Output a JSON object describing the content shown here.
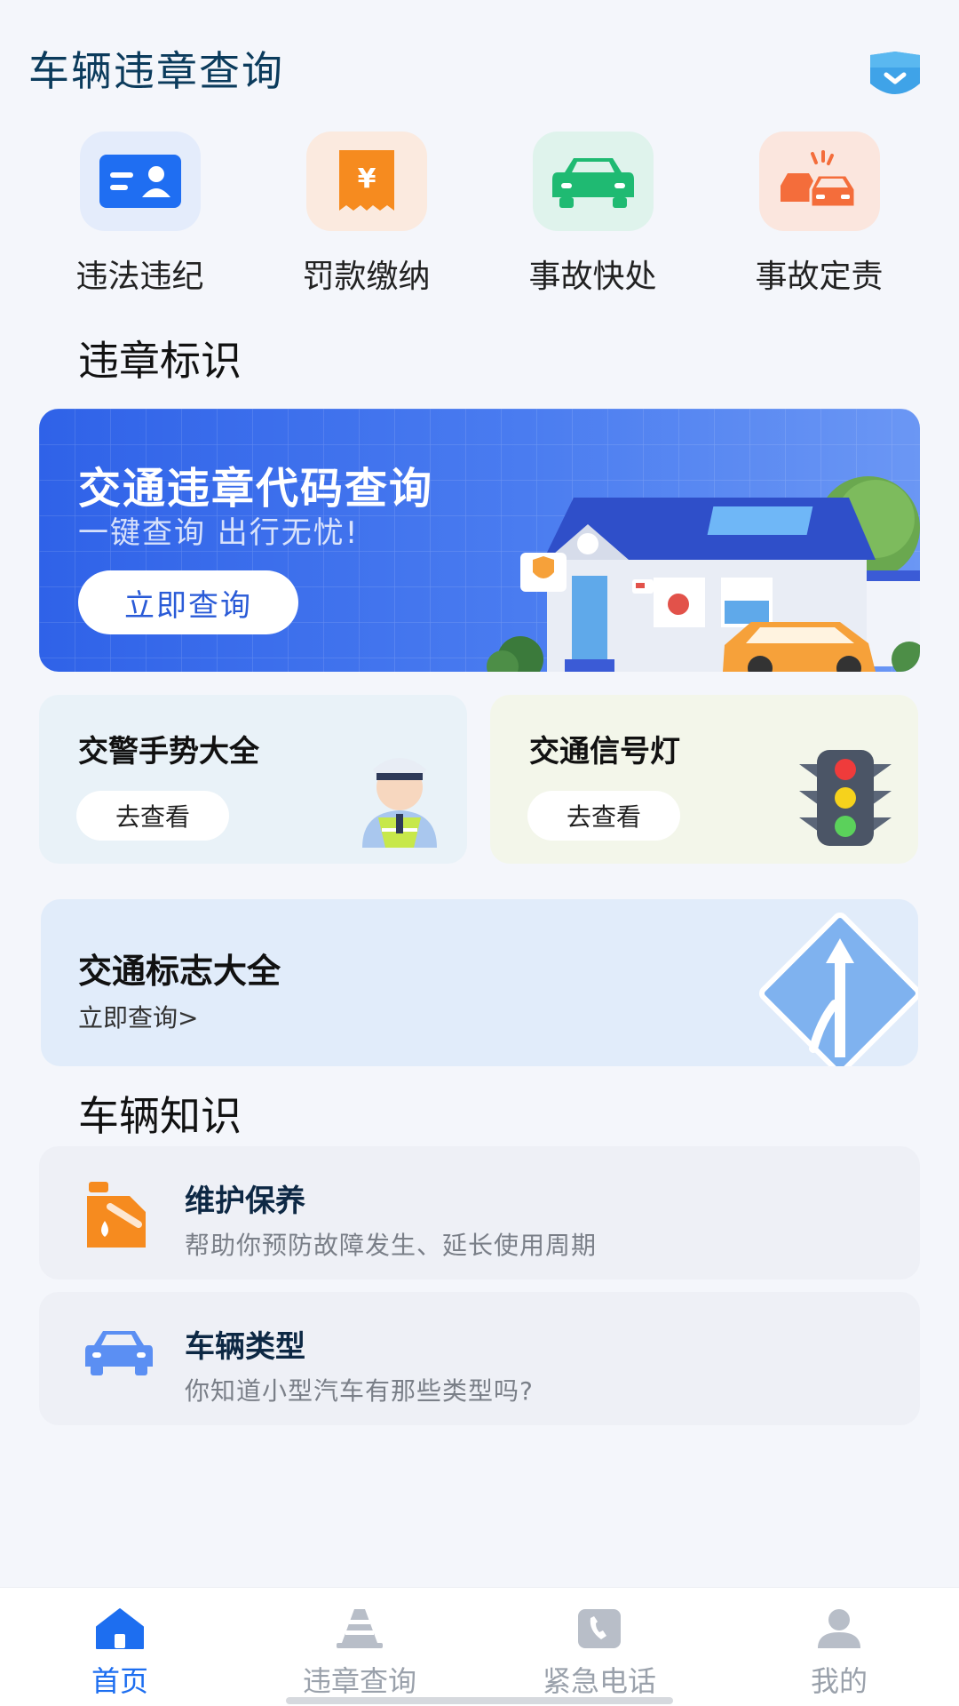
{
  "header": {
    "title": "车辆违章查询"
  },
  "quick_actions": [
    {
      "label": "违法违纪",
      "icon": "id-card-icon",
      "bg": "#e4ecfb",
      "color": "#1f6ef2"
    },
    {
      "label": "罚款缴纳",
      "icon": "receipt-yuan-icon",
      "bg": "#fbeadf",
      "color": "#f68b1f"
    },
    {
      "label": "事故快处",
      "icon": "car-icon",
      "bg": "#dff3ec",
      "color": "#1fba72"
    },
    {
      "label": "事故定责",
      "icon": "car-crash-icon",
      "bg": "#fbe6de",
      "color": "#f46d3b"
    }
  ],
  "sections": {
    "violation_signs": "违章标识",
    "vehicle_knowledge": "车辆知识"
  },
  "banner": {
    "title": "交通违章代码查询",
    "subtitle": "一键查询 出行无忧!",
    "button": "立即查询"
  },
  "cards": {
    "police": {
      "title": "交警手势大全",
      "button": "去查看"
    },
    "lights": {
      "title": "交通信号灯",
      "button": "去查看"
    }
  },
  "signs": {
    "title": "交通标志大全",
    "link": "立即查询>"
  },
  "knowledge": [
    {
      "title": "维护保养",
      "desc": "帮助你预防故障发生、延长使用周期",
      "icon": "oil-can-icon"
    },
    {
      "title": "车辆类型",
      "desc": "你知道小型汽车有那些类型吗?",
      "icon": "car-icon"
    }
  ],
  "tabs": [
    {
      "label": "首页",
      "icon": "home-icon",
      "active": true
    },
    {
      "label": "违章查询",
      "icon": "traffic-cone-icon",
      "active": false
    },
    {
      "label": "紧急电话",
      "icon": "phone-icon",
      "active": false
    },
    {
      "label": "我的",
      "icon": "user-icon",
      "active": false
    }
  ],
  "colors": {
    "accent": "#1d6ef0",
    "banner_start": "#2f62e8",
    "banner_end": "#6b97f4"
  }
}
